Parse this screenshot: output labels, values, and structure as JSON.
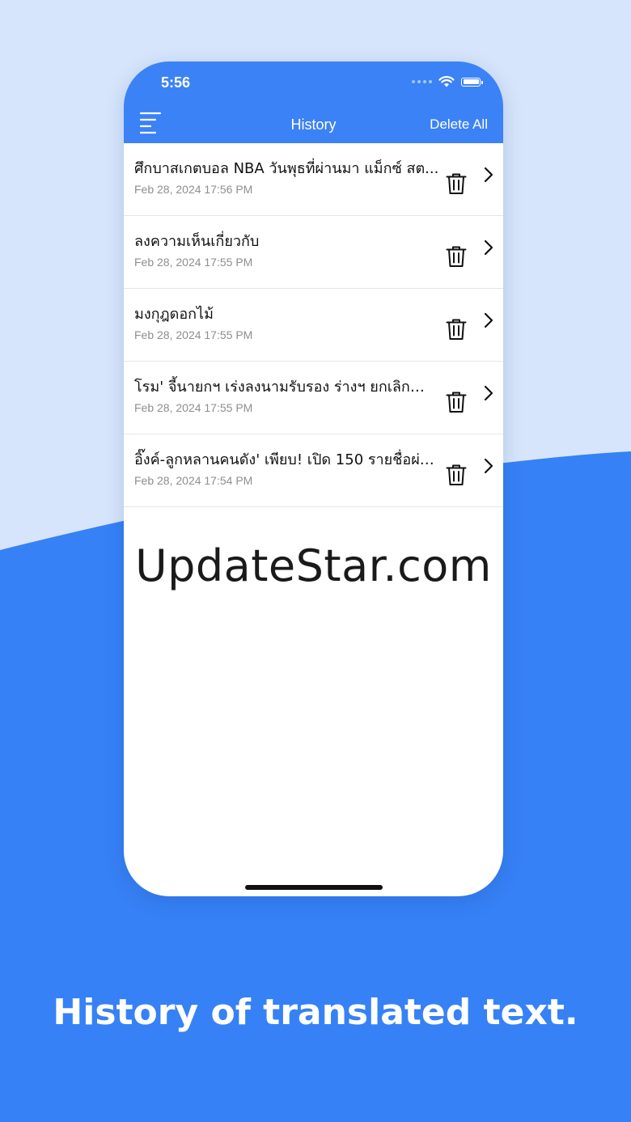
{
  "colors": {
    "accent": "#3b82f6",
    "background": "#d6e5fb",
    "wave": "#3681f5"
  },
  "status": {
    "time": "5:56"
  },
  "header": {
    "title": "History",
    "delete_all": "Delete All"
  },
  "history": [
    {
      "title": "ศึกบาสเกตบอล NBA วันพุธที่ผ่านมา แม็กซ์ สต...",
      "date": "Feb 28, 2024 17:56 PM"
    },
    {
      "title": "ลงความเห็นเกี่ยวกับ",
      "date": "Feb 28, 2024 17:55 PM"
    },
    {
      "title": "มงกุฎดอกไม้",
      "date": "Feb 28, 2024 17:55 PM"
    },
    {
      "title": "โรม' จี้นายกฯ เร่งลงนามรับรอง ร่างฯ ยกเลิกคำ...",
      "date": "Feb 28, 2024 17:55 PM"
    },
    {
      "title": "อิ๊งค์-ลูกหลานคนดัง' เพียบ! เปิด 150 รายชื่อผ่า...",
      "date": "Feb 28, 2024 17:54 PM"
    }
  ],
  "watermark": "UpdateStar.com",
  "caption": "History of translated text.",
  "icons": {
    "menu": "menu-icon",
    "delete": "trash-icon",
    "open": "chevron-right-icon",
    "wifi": "wifi-icon",
    "battery": "battery-icon",
    "signal": "signal-icon"
  }
}
